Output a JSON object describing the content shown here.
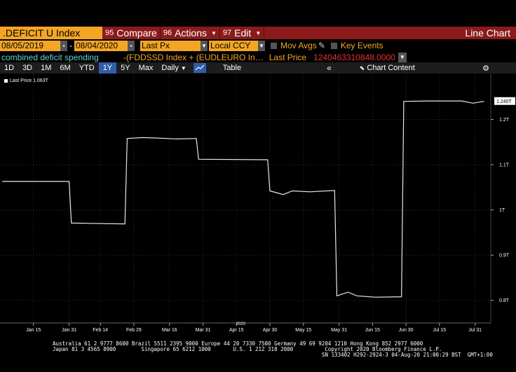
{
  "title_bar": {
    "ticker": ".DEFICIT U Index",
    "buttons": [
      {
        "num": "95",
        "label": "Compare",
        "caret": false
      },
      {
        "num": "96",
        "label": "Actions",
        "caret": true
      },
      {
        "num": "97",
        "label": "Edit",
        "caret": true
      }
    ],
    "chart_type": "Line Chart"
  },
  "date_row": {
    "start_date": "08/05/2019",
    "end_date": "08/04/2020",
    "field": "Last Px",
    "currency": "Local CCY",
    "mov_avgs": "Mov Avgs",
    "key_events": "Key Events"
  },
  "desc_row": {
    "name": "combined deficit spending",
    "formula": "-(FDDSSD Index + (EUDLEURO In…",
    "field": "Last Price",
    "value": "1240463310848.0000"
  },
  "toolbar": {
    "ranges": [
      "1D",
      "3D",
      "1M",
      "6M",
      "YTD",
      "1Y",
      "5Y",
      "Max"
    ],
    "selected_range": "1Y",
    "frequency": "Daily",
    "table_label": "Table",
    "collapse": "«",
    "chart_content_label": "Chart Content",
    "gear": "⚙"
  },
  "legend": {
    "label": "Last Price 1.063T"
  },
  "colors": {
    "accent": "#f4a623",
    "title_bar": "#8b1a1a",
    "selected": "#2f5fa8",
    "desc_name": "#5fd3d3",
    "value_red": "#e83030"
  },
  "chart_data": {
    "type": "line",
    "series": [
      {
        "name": "Last Price",
        "points": [
          [
            "2020-01-01",
            1.063
          ],
          [
            "2020-01-31",
            1.063
          ],
          [
            "2020-02-01",
            0.971
          ],
          [
            "2020-02-25",
            0.969
          ],
          [
            "2020-02-26",
            1.158
          ],
          [
            "2020-03-04",
            1.16
          ],
          [
            "2020-03-10",
            1.159
          ],
          [
            "2020-03-19",
            1.157
          ],
          [
            "2020-03-28",
            1.158
          ],
          [
            "2020-03-29",
            1.112
          ],
          [
            "2020-04-29",
            1.111
          ],
          [
            "2020-04-30",
            1.042
          ],
          [
            "2020-05-06",
            1.034
          ],
          [
            "2020-05-10",
            1.042
          ],
          [
            "2020-05-18",
            1.04
          ],
          [
            "2020-05-29",
            1.043
          ],
          [
            "2020-05-30",
            0.81
          ],
          [
            "2020-06-04",
            0.818
          ],
          [
            "2020-06-08",
            0.81
          ],
          [
            "2020-06-16",
            0.807
          ],
          [
            "2020-06-28",
            0.808
          ],
          [
            "2020-06-29",
            1.24
          ],
          [
            "2020-07-10",
            1.241
          ],
          [
            "2020-07-25",
            1.241
          ],
          [
            "2020-07-30",
            1.236
          ],
          [
            "2020-08-04",
            1.24
          ]
        ]
      }
    ],
    "x_tick_labels": [
      "Jan 15",
      "Jan 31",
      "Feb 14",
      "Feb 29",
      "Mar 16",
      "Mar 31",
      "Apr 15",
      "Apr 30",
      "May 15",
      "May 31",
      "Jun 15",
      "Jun 30",
      "Jul 15",
      "Jul 31"
    ],
    "x_tick_dates": [
      "2020-01-15",
      "2020-01-31",
      "2020-02-14",
      "2020-02-29",
      "2020-03-16",
      "2020-03-31",
      "2020-04-15",
      "2020-04-30",
      "2020-05-15",
      "2020-05-31",
      "2020-06-15",
      "2020-06-30",
      "2020-07-15",
      "2020-07-31"
    ],
    "year_label": "2020",
    "y_ticks": [
      0.8,
      0.9,
      1.0,
      1.1,
      1.2
    ],
    "y_tick_labels": [
      "0.8T",
      "0.9T",
      "1T",
      "1.1T",
      "1.2T"
    ],
    "ylim": [
      0.75,
      1.3
    ],
    "last_value_label": "1.240T",
    "last_value": 1.24,
    "grid": true
  },
  "footer": {
    "line1": "Australia 61 2 9777 8600 Brazil 5511 2395 9000 Europe 44 20 7330 7500 Germany 49 69 9204 1210 Hong Kong 852 2977 6000",
    "line2": "Japan 81 3 4565 8900        Singapore 65 6212 1000       U.S. 1 212 318 2000          Copyright 2020 Bloomberg Finance L.P.",
    "line3": "SN 133402 H292-2924-3 04-Aug-20 21:00:29 BST  GMT+1:00"
  }
}
